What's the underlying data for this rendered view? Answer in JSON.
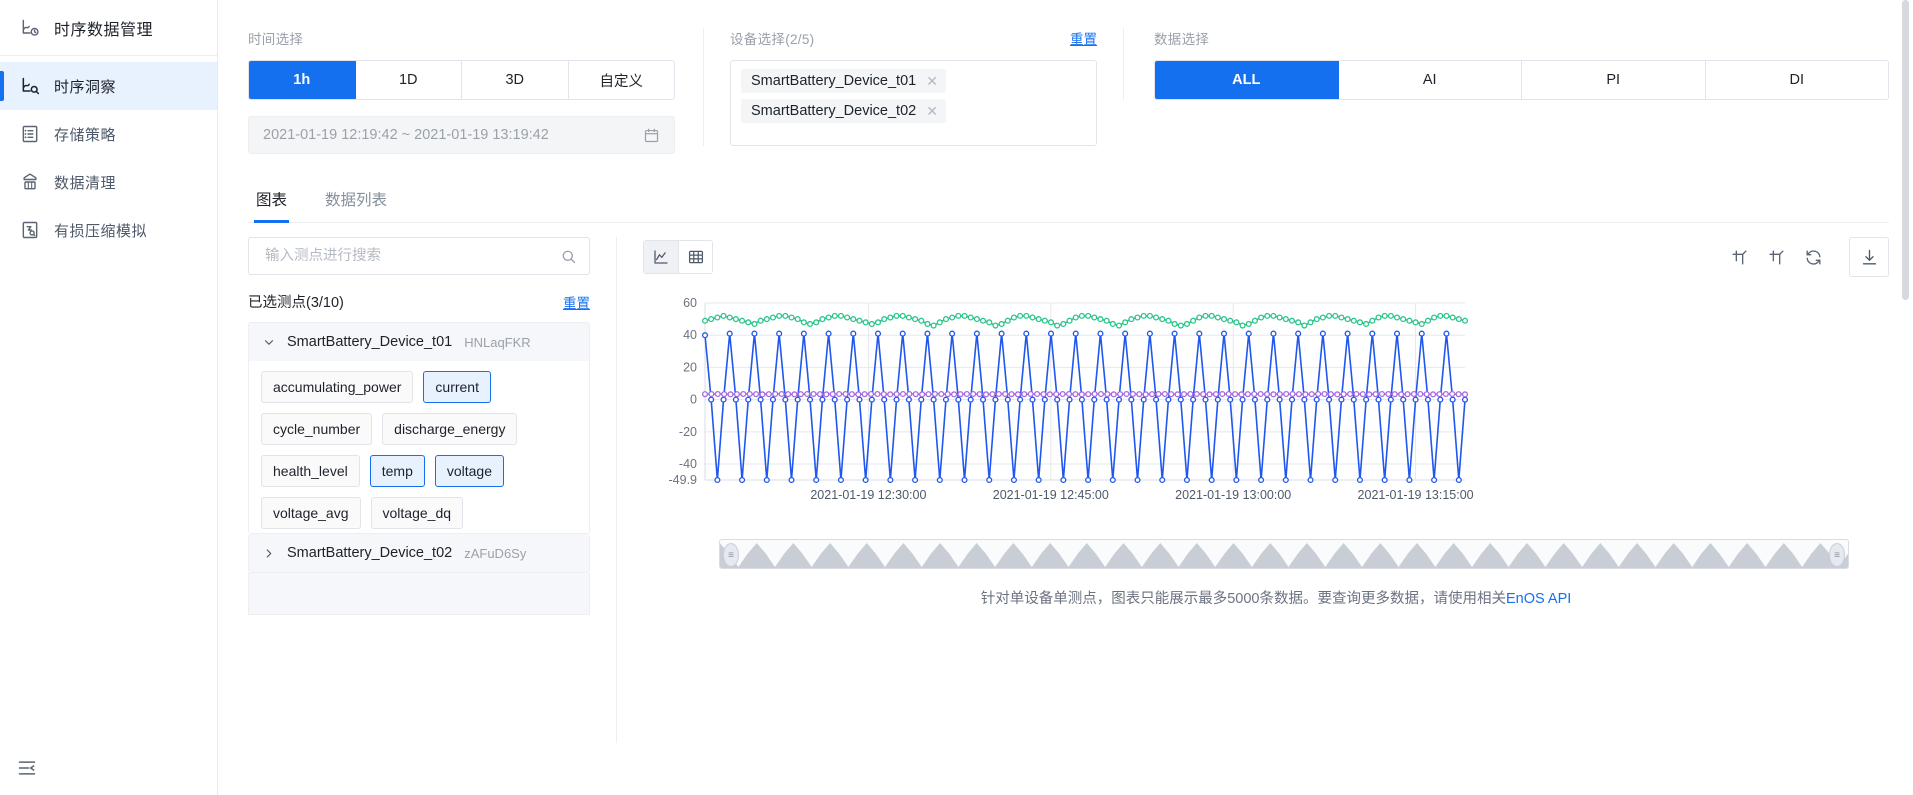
{
  "sidebar": {
    "brand": {
      "title": "时序数据管理",
      "icon": "timeseries-clock-icon"
    },
    "items": [
      {
        "label": "时序洞察",
        "icon": "insight-chart-icon",
        "active": true
      },
      {
        "label": "存储策略",
        "icon": "storage-policy-icon",
        "active": false
      },
      {
        "label": "数据清理",
        "icon": "data-clean-icon",
        "active": false
      },
      {
        "label": "有损压缩模拟",
        "icon": "compression-sim-icon",
        "active": false
      }
    ],
    "collapse_icon": "collapse-menu-icon"
  },
  "filters": {
    "time": {
      "label": "时间选择",
      "options": [
        "1h",
        "1D",
        "3D",
        "自定义"
      ],
      "selected": "1h",
      "range_value": "2021-01-19 12:19:42 ~ 2021-01-19 13:19:42",
      "calendar_icon": "calendar-icon"
    },
    "device": {
      "label": "设备选择(2/5)",
      "reset_label": "重置",
      "tags": [
        "SmartBattery_Device_t01",
        "SmartBattery_Device_t02"
      ],
      "remove_icon": "close-icon"
    },
    "data": {
      "label": "数据选择",
      "options": [
        "ALL",
        "AI",
        "PI",
        "DI"
      ],
      "selected": "ALL"
    }
  },
  "tabs": [
    {
      "label": "图表",
      "active": true
    },
    {
      "label": "数据列表",
      "active": false
    }
  ],
  "measure_panel": {
    "search": {
      "placeholder": "输入测点进行搜索",
      "value": "",
      "icon": "search-icon"
    },
    "selected_label": "已选测点(3/10)",
    "reset_label": "重置",
    "groups": [
      {
        "name": "SmartBattery_Device_t01",
        "id": "HNLaqFKR",
        "expanded": true,
        "caret_icon": "chevron-down-icon",
        "points": [
          {
            "label": "accumulating_power",
            "selected": false
          },
          {
            "label": "current",
            "selected": true
          },
          {
            "label": "cycle_number",
            "selected": false
          },
          {
            "label": "discharge_energy",
            "selected": false
          },
          {
            "label": "health_level",
            "selected": false
          },
          {
            "label": "temp",
            "selected": true
          },
          {
            "label": "voltage",
            "selected": true
          },
          {
            "label": "voltage_avg",
            "selected": false
          },
          {
            "label": "voltage_dq",
            "selected": false
          }
        ]
      },
      {
        "name": "SmartBattery_Device_t02",
        "id": "zAFuD6Sy",
        "expanded": false,
        "caret_icon": "chevron-right-icon",
        "points": []
      }
    ]
  },
  "chart_panel": {
    "view_toggle": [
      {
        "icon": "line-chart-icon",
        "active": true
      },
      {
        "icon": "table-grid-icon",
        "active": false
      }
    ],
    "tools": [
      {
        "icon": "crop-zoom-icon"
      },
      {
        "icon": "undo-zoom-icon"
      },
      {
        "icon": "refresh-icon"
      }
    ],
    "download_icon": "download-icon",
    "zoom_slider": {
      "left_handle_icon": "drag-handle-icon",
      "right_handle_icon": "drag-handle-icon"
    },
    "footnote_text": "针对单设备单测点，图表只能展示最多5000条数据。要查询更多数据，请使用相关",
    "footnote_link": "EnOS API"
  },
  "chart_data": {
    "type": "line",
    "title": "",
    "xlabel": "",
    "ylabel": "",
    "ylim": [
      -49.9,
      60
    ],
    "yticks": [
      60,
      40,
      20,
      0,
      -20,
      -40,
      -49.9
    ],
    "ytick_labels": [
      "60",
      "40",
      "20",
      "0",
      "-20",
      "-40",
      "-49.9"
    ],
    "grid": true,
    "xtick_labels": [
      "2021-01-19 12:30:00",
      "2021-01-19 12:45:00",
      "2021-01-19 13:00:00",
      "2021-01-19 13:15:00"
    ],
    "xtick_positions": [
      0.215,
      0.455,
      0.695,
      0.935
    ],
    "legend": "none",
    "colors": {
      "temp": "#2bc48a",
      "current": "#1f57ef",
      "voltage": "#a569e0"
    },
    "series": [
      {
        "name": "temp",
        "color": "#2bc48a",
        "values": [
          49,
          50,
          51,
          52,
          51,
          50,
          49,
          48,
          47,
          49,
          50,
          51,
          52,
          52,
          51,
          50,
          48,
          47,
          48,
          50,
          51,
          52,
          52,
          51,
          50,
          49,
          48,
          47,
          48,
          50,
          51,
          52,
          52,
          51,
          50,
          49,
          47,
          46,
          48,
          50,
          51,
          52,
          52,
          51,
          50,
          49,
          48,
          46,
          47,
          49,
          51,
          52,
          52,
          51,
          50,
          49,
          48,
          46,
          47,
          49,
          51,
          52,
          52,
          51,
          50,
          49,
          47,
          46,
          48,
          50,
          51,
          52,
          52,
          51,
          50,
          49,
          47,
          46,
          47,
          49,
          51,
          52,
          52,
          51,
          50,
          49,
          48,
          46,
          47,
          49,
          51,
          52,
          52,
          51,
          50,
          49,
          48,
          46,
          48,
          50,
          51,
          52,
          52,
          51,
          50,
          49,
          48,
          47,
          49,
          51,
          52,
          52,
          51,
          50,
          49,
          48,
          47,
          49,
          51,
          52,
          52,
          51,
          50,
          49
        ]
      },
      {
        "name": "current",
        "color": "#1f57ef",
        "values": [
          40,
          0,
          -49.9,
          0,
          41,
          0,
          -49.9,
          0,
          41,
          0,
          -49.9,
          0,
          41,
          0,
          -49.9,
          0,
          41,
          0,
          -49.9,
          0,
          41,
          0,
          -49.9,
          0,
          41,
          0,
          -49.9,
          0,
          41,
          0,
          -49.9,
          0,
          41,
          0,
          -49.9,
          0,
          41,
          0,
          -49.9,
          0,
          41,
          0,
          -49.9,
          0,
          41,
          0,
          -49.9,
          0,
          41,
          0,
          -49.9,
          0,
          41,
          0,
          -49.9,
          0,
          41,
          0,
          -49.9,
          0,
          41,
          0,
          -49.9,
          0,
          41,
          0,
          -49.9,
          0,
          41,
          0,
          -49.9,
          0,
          41,
          0,
          -49.9,
          0,
          41,
          0,
          -49.9,
          0,
          41,
          0,
          -49.9,
          0,
          41,
          0,
          -49.9,
          0,
          41,
          0,
          -49.9,
          0,
          41,
          0,
          -49.9,
          0,
          41,
          0,
          -49.9,
          0,
          41,
          0,
          -49.9,
          0,
          41,
          0,
          -49.9,
          0,
          41,
          0,
          -49.9,
          0,
          41,
          0,
          -49.9,
          0,
          41,
          0,
          -49.9,
          0,
          41,
          0,
          -49.9,
          0
        ]
      },
      {
        "name": "voltage",
        "color": "#a569e0",
        "values": [
          3.4,
          3.5,
          3.5,
          3.4,
          3.3,
          3.4,
          3.5,
          3.5,
          3.4,
          3.3,
          3.4,
          3.5,
          3.5,
          3.4,
          3.3,
          3.4,
          3.5,
          3.5,
          3.4,
          3.3,
          3.4,
          3.5,
          3.5,
          3.4,
          3.3,
          3.4,
          3.5,
          3.5,
          3.4,
          3.3,
          3.4,
          3.5,
          3.5,
          3.4,
          3.3,
          3.4,
          3.5,
          3.5,
          3.4,
          3.3,
          3.4,
          3.5,
          3.5,
          3.4,
          3.3,
          3.4,
          3.5,
          3.5,
          3.4,
          3.3,
          3.4,
          3.5,
          3.5,
          3.4,
          3.3,
          3.4,
          3.5,
          3.5,
          3.4,
          3.3,
          3.4,
          3.5,
          3.5,
          3.4,
          3.3,
          3.4,
          3.5,
          3.5,
          3.4,
          3.3,
          3.4,
          3.5,
          3.5,
          3.4,
          3.3,
          3.4,
          3.5,
          3.5,
          3.4,
          3.3,
          3.4,
          3.5,
          3.5,
          3.4,
          3.3,
          3.4,
          3.5,
          3.5,
          3.4,
          3.3,
          3.4,
          3.5,
          3.5,
          3.4,
          3.3,
          3.4,
          3.5,
          3.5,
          3.4,
          3.3,
          3.4,
          3.5,
          3.5,
          3.4,
          3.3,
          3.4,
          3.5,
          3.5,
          3.4,
          3.3,
          3.4,
          3.5,
          3.5,
          3.4,
          3.3,
          3.4,
          3.5,
          3.5,
          3.4,
          3.3
        ]
      }
    ]
  }
}
